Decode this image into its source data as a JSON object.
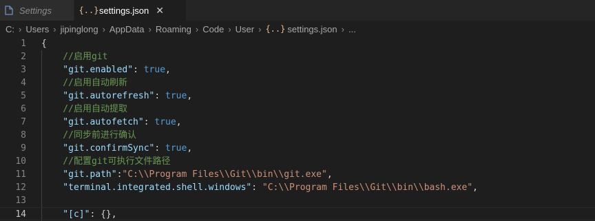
{
  "tabs": [
    {
      "label": "Settings",
      "active": false,
      "icon": "file-icon"
    },
    {
      "label": "settings.json",
      "active": true,
      "icon": "json-braces-icon",
      "close": "✕"
    }
  ],
  "breadcrumb": {
    "parts": [
      "C:",
      "Users",
      "jipinglong",
      "AppData",
      "Roaming",
      "Code",
      "User"
    ],
    "file_icon": "{..}",
    "file": "settings.json",
    "tail": "...",
    "separator": "›"
  },
  "editor": {
    "current_line": 14,
    "lines": [
      {
        "n": "1",
        "tokens": [
          {
            "t": "{",
            "c": "punc"
          }
        ]
      },
      {
        "n": "2",
        "tokens": [
          {
            "t": "    //启用git",
            "c": "comment"
          }
        ]
      },
      {
        "n": "3",
        "tokens": [
          {
            "t": "    \"git.enabled\"",
            "c": "key"
          },
          {
            "t": ": ",
            "c": "punc"
          },
          {
            "t": "true",
            "c": "bool"
          },
          {
            "t": ",",
            "c": "punc"
          }
        ]
      },
      {
        "n": "4",
        "tokens": [
          {
            "t": "    //启用自动刷新",
            "c": "comment"
          }
        ]
      },
      {
        "n": "5",
        "tokens": [
          {
            "t": "    \"git.autorefresh\"",
            "c": "key"
          },
          {
            "t": ": ",
            "c": "punc"
          },
          {
            "t": "true",
            "c": "bool"
          },
          {
            "t": ",",
            "c": "punc"
          }
        ]
      },
      {
        "n": "6",
        "tokens": [
          {
            "t": "    //启用自动提取",
            "c": "comment"
          }
        ]
      },
      {
        "n": "7",
        "tokens": [
          {
            "t": "    \"git.autofetch\"",
            "c": "key"
          },
          {
            "t": ": ",
            "c": "punc"
          },
          {
            "t": "true",
            "c": "bool"
          },
          {
            "t": ",",
            "c": "punc"
          }
        ]
      },
      {
        "n": "8",
        "tokens": [
          {
            "t": "    //同步前进行确认",
            "c": "comment"
          }
        ]
      },
      {
        "n": "9",
        "tokens": [
          {
            "t": "    \"git.confirmSync\"",
            "c": "key"
          },
          {
            "t": ": ",
            "c": "punc"
          },
          {
            "t": "true",
            "c": "bool"
          },
          {
            "t": ",",
            "c": "punc"
          }
        ]
      },
      {
        "n": "10",
        "tokens": [
          {
            "t": "    //配置git可执行文件路径",
            "c": "comment"
          }
        ]
      },
      {
        "n": "11",
        "tokens": [
          {
            "t": "    \"git.path\"",
            "c": "key"
          },
          {
            "t": ":",
            "c": "punc"
          },
          {
            "t": "\"C:\\\\Program Files\\\\Git\\\\bin\\\\git.exe\"",
            "c": "str"
          },
          {
            "t": ",",
            "c": "punc"
          }
        ]
      },
      {
        "n": "12",
        "tokens": [
          {
            "t": "    \"terminal.integrated.shell.windows\"",
            "c": "key"
          },
          {
            "t": ": ",
            "c": "punc"
          },
          {
            "t": "\"C:\\\\Program Files\\\\Git\\\\bin\\\\bash.exe\"",
            "c": "str"
          },
          {
            "t": ",",
            "c": "punc"
          }
        ]
      },
      {
        "n": "13",
        "tokens": []
      },
      {
        "n": "14",
        "tokens": [
          {
            "t": "    \"[c]\"",
            "c": "key"
          },
          {
            "t": ": {},",
            "c": "punc"
          }
        ]
      }
    ]
  }
}
